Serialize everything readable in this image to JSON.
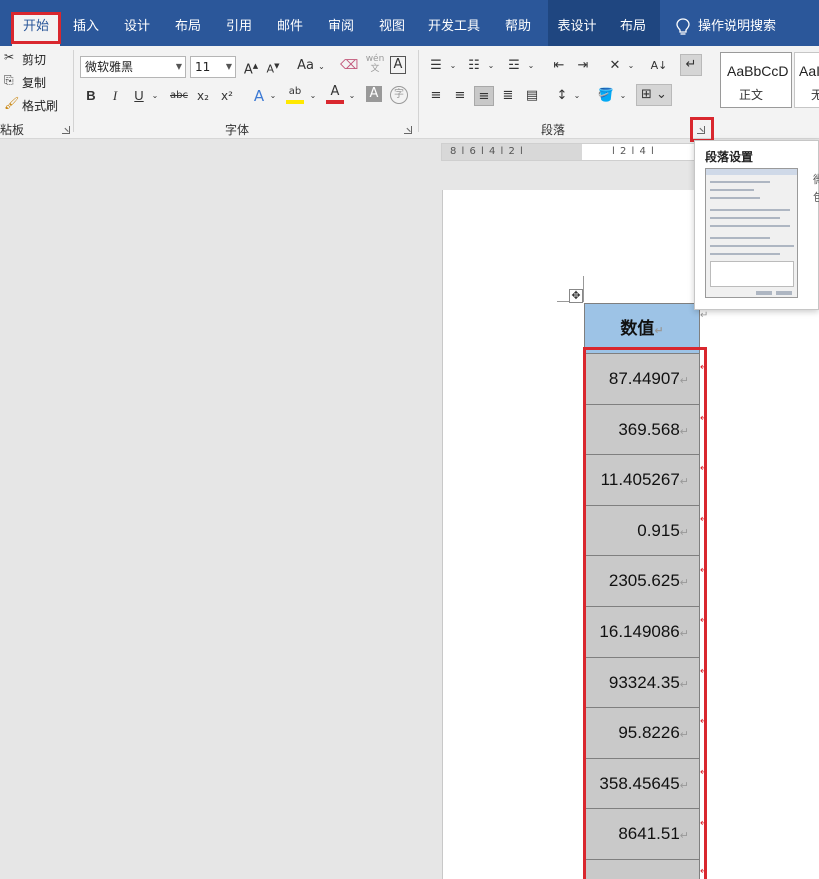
{
  "tabs": [
    {
      "label": "开始",
      "active": true
    },
    {
      "label": "插入"
    },
    {
      "label": "设计"
    },
    {
      "label": "布局"
    },
    {
      "label": "引用"
    },
    {
      "label": "邮件"
    },
    {
      "label": "审阅"
    },
    {
      "label": "视图"
    },
    {
      "label": "开发工具"
    },
    {
      "label": "帮助"
    },
    {
      "label": "表设计",
      "contextual": true
    },
    {
      "label": "布局",
      "contextual": true
    }
  ],
  "search": {
    "icon": "lightbulb-icon",
    "label": "操作说明搜索"
  },
  "clipboard": {
    "cut": "剪切",
    "copy": "复制",
    "format_painter": "格式刷",
    "group_label": "粘板"
  },
  "font": {
    "name": "微软雅黑",
    "size": "11",
    "group_label": "字体",
    "grow": "A",
    "shrink": "A",
    "case": "Aa",
    "wen": "wén",
    "bold": "B",
    "italic": "I",
    "underline": "U",
    "strike": "abc",
    "sub": "x₂",
    "sup": "x²",
    "effect": "A",
    "highlight": "ab",
    "color": "A",
    "shade": "A",
    "circle": "字"
  },
  "paragraph": {
    "group_label": "段落"
  },
  "styles": [
    {
      "preview": "AaBbCcD",
      "name": "正文"
    },
    {
      "preview": "AaI",
      "name": "无"
    }
  ],
  "tooltip": {
    "title": "段落设置",
    "side_1": "微",
    "side_2": "包"
  },
  "ruler": {
    "left": "8  l  6  l  4  l  2  l",
    "right": "l 2 l  4 l"
  },
  "move_handle_icon": "✥",
  "table": {
    "header": "数值",
    "rows": [
      "87.44907",
      "369.568",
      "11.405267",
      "0.915",
      "2305.625",
      "16.149086",
      "93324.35",
      "95.8226",
      "358.45645",
      "8641.51",
      ""
    ]
  },
  "colors": {
    "tabbar": "#2b579a",
    "highlight_box": "#d9272e",
    "header_fill": "#9dc3e6",
    "cell_fill": "#c9c9c9"
  }
}
